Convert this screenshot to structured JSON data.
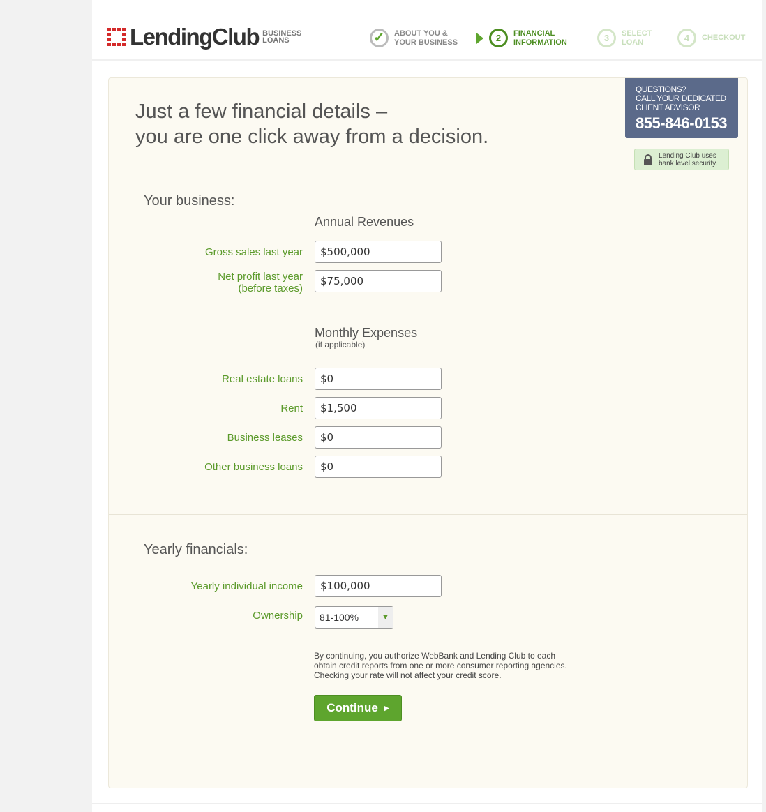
{
  "header": {
    "logo_name": "LendingClub",
    "logo_sub1": "BUSINESS",
    "logo_sub2": "LOANS",
    "steps": [
      {
        "num": "✓",
        "line1": "ABOUT YOU &",
        "line2": "YOUR BUSINESS",
        "state": "done"
      },
      {
        "num": "2",
        "line1": "FINANCIAL",
        "line2": "INFORMATION",
        "state": "current"
      },
      {
        "num": "3",
        "line1": "SELECT",
        "line2": "LOAN",
        "state": "upcoming"
      },
      {
        "num": "4",
        "line1": "CHECKOUT",
        "line2": "",
        "state": "upcoming"
      }
    ]
  },
  "headline": {
    "line1": "Just a few financial details –",
    "line2": "you are one click away from a decision."
  },
  "advisor": {
    "l1": "QUESTIONS?",
    "l2": "CALL YOUR DEDICATED",
    "l3": "CLIENT ADVISOR",
    "phone": "855-846-0153"
  },
  "security": {
    "l1": "Lending Club uses",
    "l2": "bank level security."
  },
  "business": {
    "title": "Your business:",
    "revenues_title": "Annual Revenues",
    "gross_label": "Gross sales last year",
    "gross_value": "$500,000",
    "net_label1": "Net profit last year",
    "net_label2": "(before taxes)",
    "net_value": "$75,000",
    "expenses_title": "Monthly Expenses",
    "expenses_note": "(if applicable)",
    "expenses": [
      {
        "label": "Real estate loans",
        "value": "$0"
      },
      {
        "label": "Rent",
        "value": "$1,500"
      },
      {
        "label": "Business leases",
        "value": "$0"
      },
      {
        "label": "Other business loans",
        "value": "$0"
      }
    ]
  },
  "yearly": {
    "title": "Yearly financials:",
    "income_label": "Yearly individual income",
    "income_value": "$100,000",
    "ownership_label": "Ownership",
    "ownership_value": "81-100%"
  },
  "legal": "By continuing, you authorize WebBank and Lending Club to each obtain credit reports from one or more consumer reporting agencies. Checking your rate will not affect your credit score.",
  "continue_label": "Continue",
  "colors": {
    "accent": "#5ea52e",
    "label": "#5b9a2b",
    "advisor_bg": "#5b6a8a",
    "panel_bg": "#fcfaf2"
  }
}
